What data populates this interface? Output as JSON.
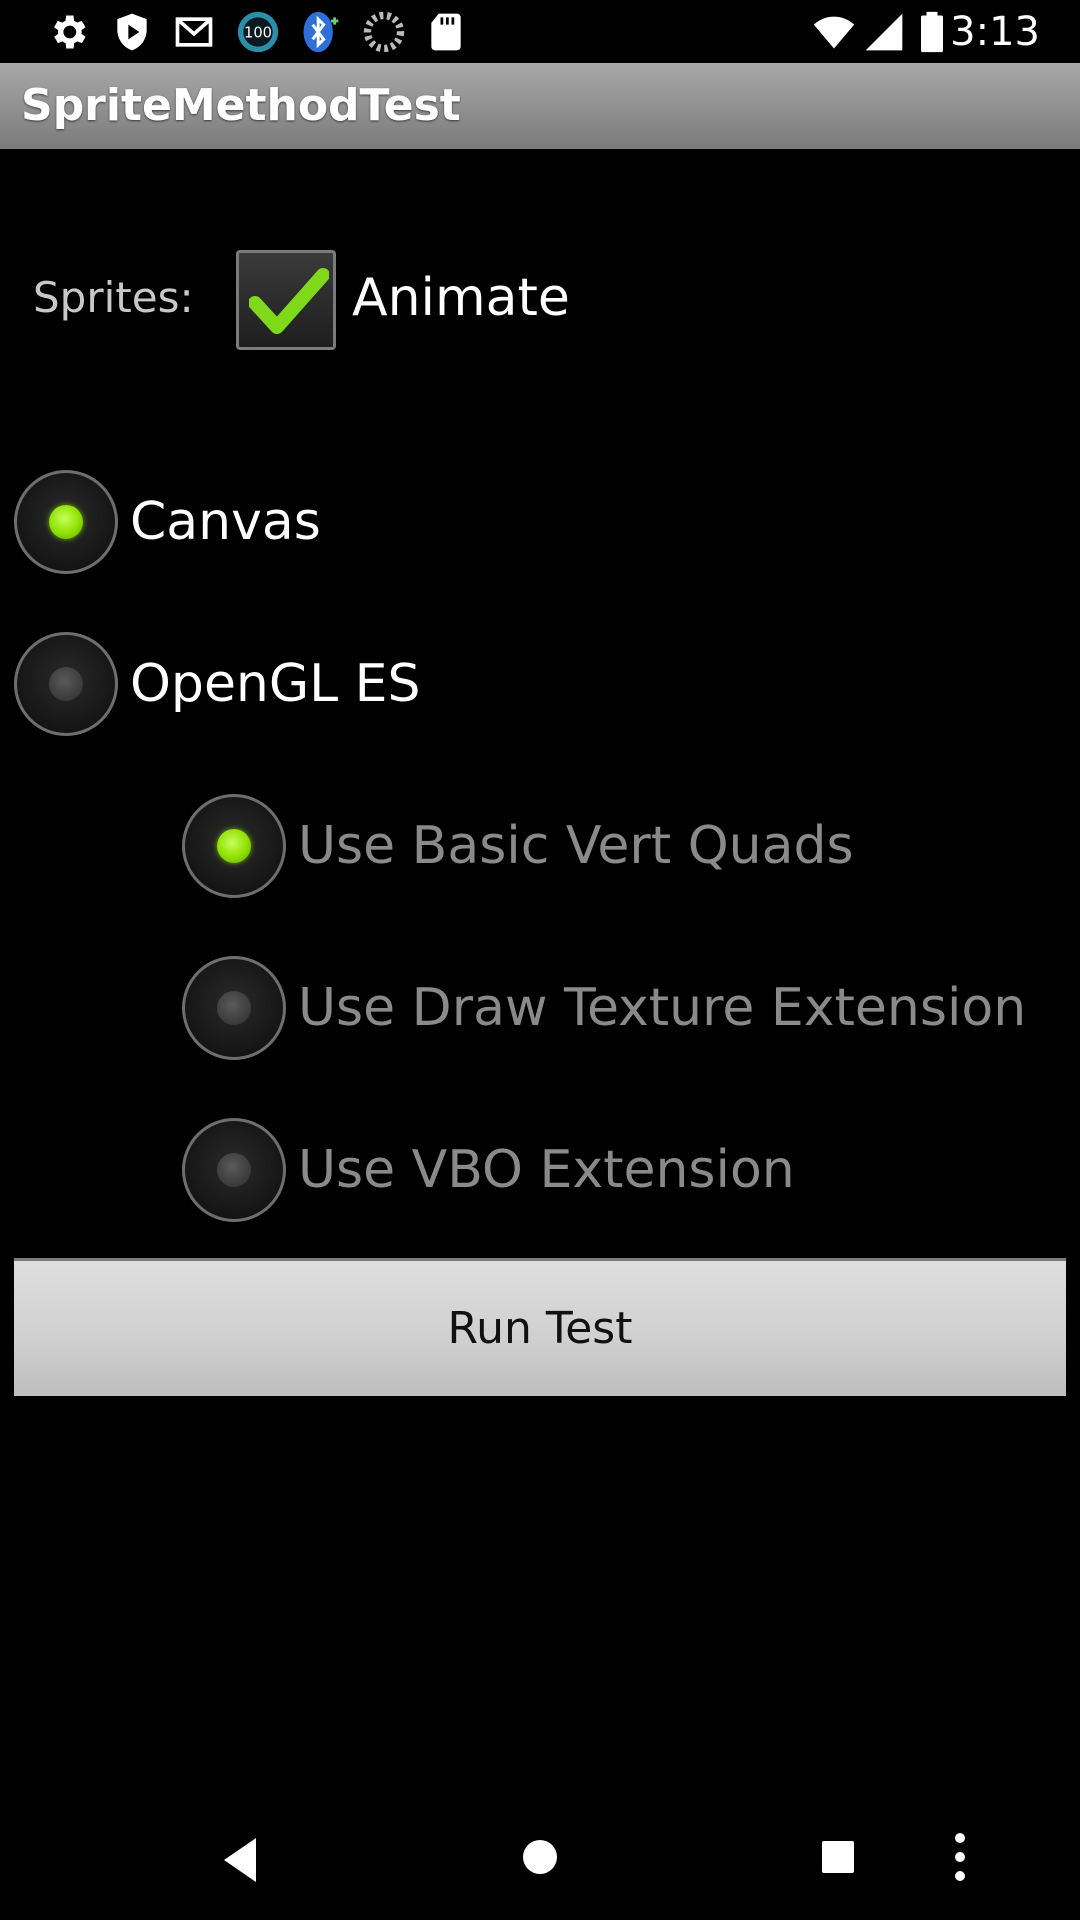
{
  "status_bar": {
    "time": "3:13",
    "icons": [
      "settings-icon",
      "shield-icon",
      "gmail-icon",
      "battery-100-badge-icon",
      "bluetooth-icon",
      "loading-icon",
      "sd-card-icon",
      "wifi-icon",
      "cell-signal-icon",
      "battery-icon"
    ],
    "badge_text": "100"
  },
  "app": {
    "title": "SpriteMethodTest"
  },
  "sprites": {
    "label": "Sprites:",
    "animate_label": "Animate",
    "animate_checked": true
  },
  "renderers": [
    {
      "label": "Canvas",
      "selected": true
    },
    {
      "label": "OpenGL ES",
      "selected": false
    }
  ],
  "gl_options": [
    {
      "label": "Use Basic Vert Quads",
      "selected": true
    },
    {
      "label": "Use Draw Texture Extension",
      "selected": false
    },
    {
      "label": "Use VBO Extension",
      "selected": false
    }
  ],
  "run_button": {
    "label": "Run Test"
  },
  "colors": {
    "accent_green": "#8ee000",
    "title_bar": "#8f8f8f",
    "disabled_text": "#8a8a8a"
  },
  "nav_bar": {
    "icons": [
      "back-icon",
      "home-icon",
      "recents-icon",
      "menu-icon"
    ]
  }
}
